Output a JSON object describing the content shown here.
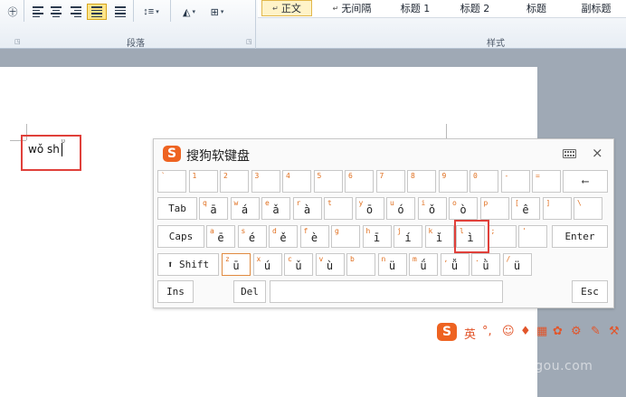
{
  "ribbon": {
    "paragraph_group_label": "段落",
    "styles_group_label": "样式",
    "styles": [
      "正文",
      "无间隔",
      "标题 1",
      "标题 2",
      "标题",
      "副标题"
    ]
  },
  "document": {
    "typed_text": "wǒ sh"
  },
  "keyboard": {
    "title": "搜狗软键盘",
    "close_label": "×",
    "row1": [
      {
        "top": "~",
        "main": "`"
      },
      {
        "top": "!",
        "main": "1"
      },
      {
        "top": "@",
        "main": "2"
      },
      {
        "top": "#",
        "main": "3"
      },
      {
        "top": "$",
        "main": "4"
      },
      {
        "top": "%",
        "main": "5"
      },
      {
        "top": "^",
        "main": "6"
      },
      {
        "top": "&",
        "main": "7"
      },
      {
        "top": "*",
        "main": "8"
      },
      {
        "top": "(",
        "main": "9"
      },
      {
        "top": ")",
        "main": "0"
      },
      {
        "top": "_",
        "main": "-"
      },
      {
        "top": "+",
        "main": "="
      }
    ],
    "backspace_label": "⟵",
    "tab_label": "Tab",
    "row2": [
      {
        "top": "q",
        "main": "ā"
      },
      {
        "top": "w",
        "main": "á"
      },
      {
        "top": "e",
        "main": "ǎ"
      },
      {
        "top": "r",
        "main": "à"
      },
      {
        "top": "t",
        "main": ""
      },
      {
        "top": "y",
        "main": "ō"
      },
      {
        "top": "u",
        "main": "ó"
      },
      {
        "top": "i",
        "main": "ǒ"
      },
      {
        "top": "o",
        "main": "ò"
      },
      {
        "top": "p",
        "main": ""
      },
      {
        "top": "[",
        "main": "ê"
      },
      {
        "top": "]",
        "main": ""
      },
      {
        "top": "\\",
        "main": ""
      }
    ],
    "caps_label": "Caps",
    "row3": [
      {
        "top": "a",
        "main": "ē"
      },
      {
        "top": "s",
        "main": "é"
      },
      {
        "top": "d",
        "main": "ě"
      },
      {
        "top": "f",
        "main": "è"
      },
      {
        "top": "g",
        "main": ""
      },
      {
        "top": "h",
        "main": "ī"
      },
      {
        "top": "j",
        "main": "í"
      },
      {
        "top": "k",
        "main": "ǐ"
      },
      {
        "top": "l",
        "main": "ì"
      },
      {
        "top": ";",
        "main": ""
      },
      {
        "top": "'",
        "main": ""
      }
    ],
    "enter_label": "Enter",
    "shift_label": "⬆ Shift",
    "row4": [
      {
        "top": "z",
        "main": "ū"
      },
      {
        "top": "x",
        "main": "ú"
      },
      {
        "top": "c",
        "main": "ǔ"
      },
      {
        "top": "v",
        "main": "ù"
      },
      {
        "top": "b",
        "main": ""
      },
      {
        "top": "n",
        "main": "ü"
      },
      {
        "top": "m",
        "main": "ǘ"
      },
      {
        "top": ",",
        "main": "ǚ"
      },
      {
        "top": ".",
        "main": "ǜ"
      },
      {
        "top": "/",
        "main": "ü"
      }
    ],
    "ins_label": "Ins",
    "del_label": "Del",
    "esc_label": "Esc"
  },
  "watermark": "shnenansgou.com",
  "accent_color": "#ee6321",
  "highlight_color": "#e0403a"
}
